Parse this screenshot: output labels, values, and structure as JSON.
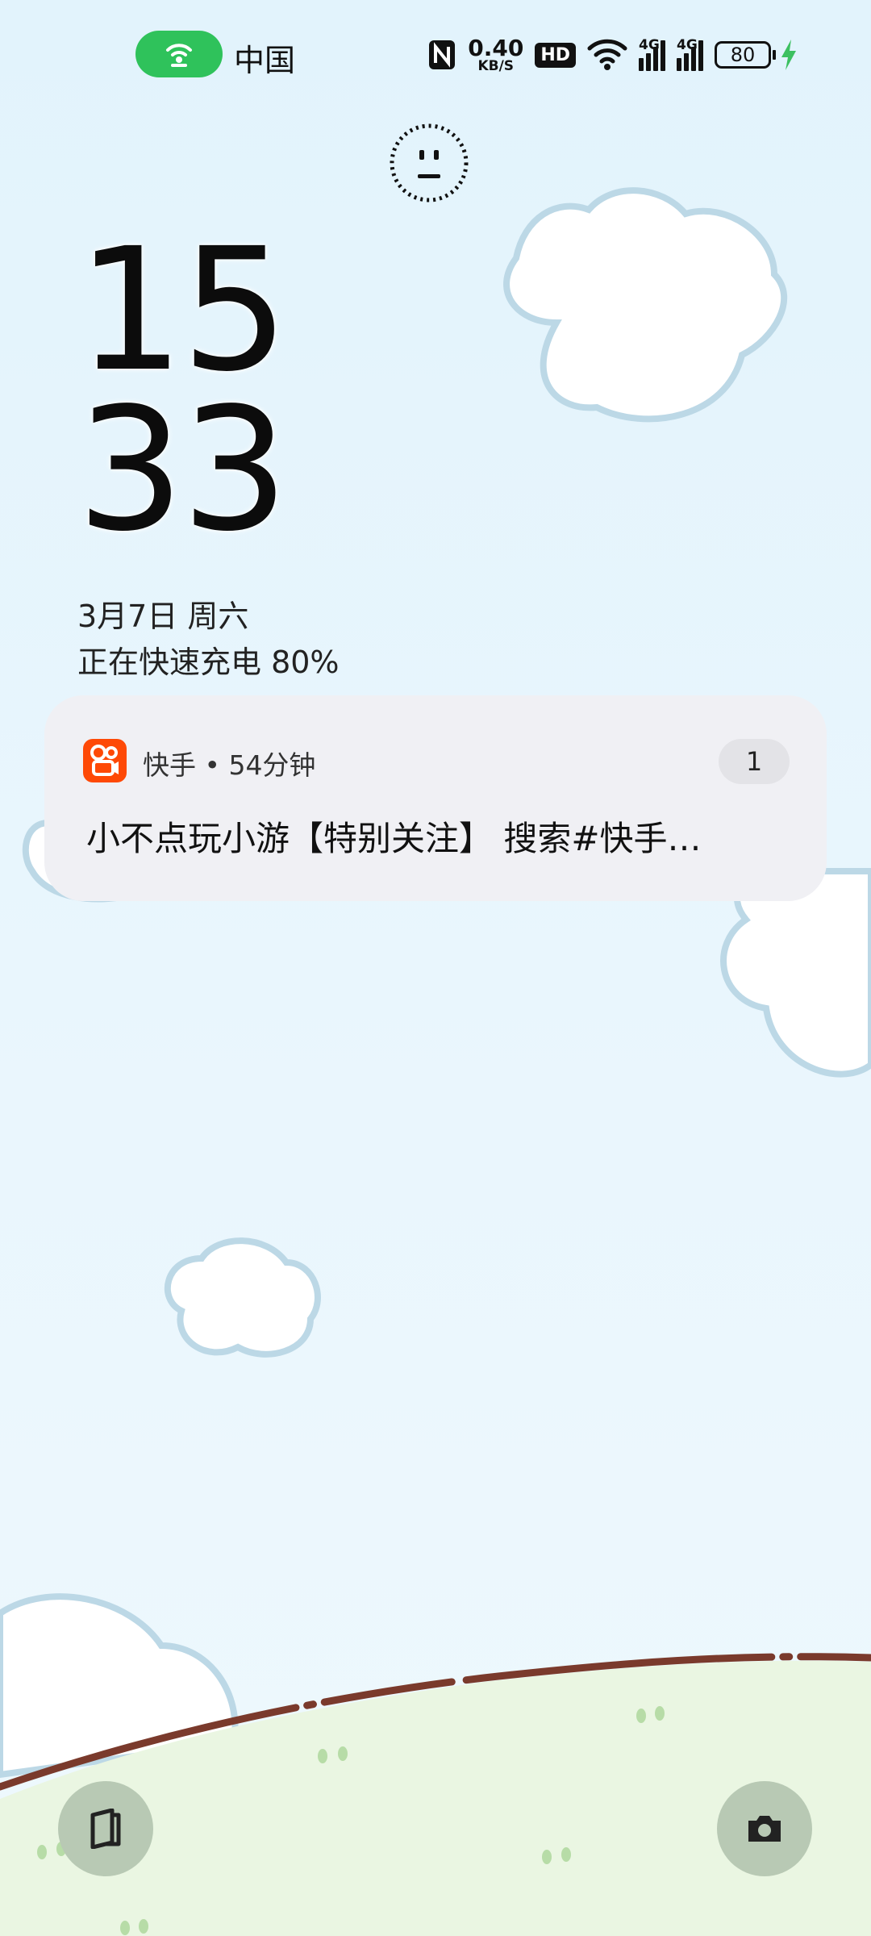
{
  "status_bar": {
    "carrier": "中国",
    "net_speed_value": "0.40",
    "net_speed_unit": "KB/S",
    "hd_label": "HD",
    "sim1_label": "4G",
    "sim2_label": "4G",
    "battery_level": "80",
    "hotspot_color": "#2fc25b",
    "charging_color": "#3cc060"
  },
  "lockscreen": {
    "hour": "15",
    "minute": "33",
    "date": "3月7日 周六",
    "charging_text": "正在快速充电 80%"
  },
  "notification": {
    "app_meta": "快手 • 54分钟",
    "count": "1",
    "text": "小不点玩小游【特别关注】 搜索#快手…",
    "app_color": "#fe4906"
  },
  "bottom": {
    "left_icon": "wallet-icon",
    "right_icon": "camera-icon"
  }
}
